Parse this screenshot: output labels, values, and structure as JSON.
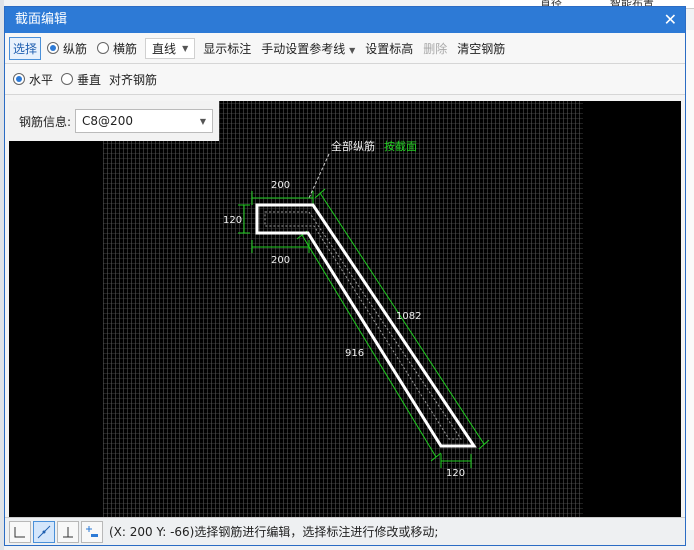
{
  "window": {
    "title": "截面编辑",
    "close_icon": "close-icon"
  },
  "bg": {
    "item1": "直径",
    "item2": "智能布置"
  },
  "toolbar": {
    "select": "选择",
    "longitudinal": "纵筋",
    "transverse": "横筋",
    "line_type": "直线",
    "show_dims": "显示标注",
    "manual_ref": "手动设置参考线",
    "set_elev": "设置标高",
    "delete": "删除",
    "clear": "清空钢筋"
  },
  "toolbar2": {
    "horizontal": "水平",
    "vertical": "垂直",
    "align": "对齐钢筋"
  },
  "rebar_info": {
    "label": "钢筋信息:",
    "value": "C8@200"
  },
  "drawing": {
    "top_label": "全部纵筋",
    "top_label_green": "按截面",
    "dim_top": "200",
    "dim_left": "120",
    "dim_bottom": "200",
    "dim_long_outer": "1082",
    "dim_long_inner": "916",
    "dim_end": "120"
  },
  "status": {
    "text": "(X: 200 Y: -66)选择钢筋进行编辑，选择标注进行修改或移动;"
  },
  "colors": {
    "accent": "#2d7ad6",
    "dim_green": "#1aa31a",
    "rebar": "#ffffff"
  }
}
